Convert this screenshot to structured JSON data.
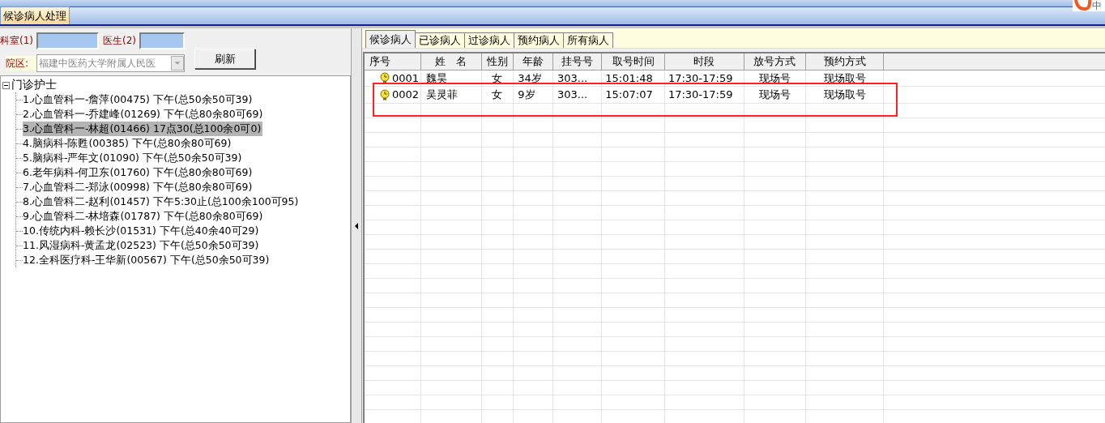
{
  "ime": {
    "label": "中"
  },
  "module_tabs": [
    {
      "label": "候诊病人处理",
      "selected": true
    }
  ],
  "filters": {
    "dept_label": "科室(1)",
    "doctor_label": "医生(2)",
    "campus_label": "院区:",
    "campus_value": "福建中医药大学附属人民医",
    "refresh_button": "刷新"
  },
  "tree": {
    "root": {
      "label": "门诊护士",
      "expanded": true,
      "children": [
        {
          "label": "1.心血管科一-詹萍(00475) 下午(总50余50可39)",
          "selected": false
        },
        {
          "label": "2.心血管科一-乔建峰(01269) 下午(总80余80可69)",
          "selected": false
        },
        {
          "label": "3.心血管科一-林超(01466) 17点30(总100余0可0)",
          "selected": true
        },
        {
          "label": "4.脑病科-陈甦(00385) 下午(总80余80可69)",
          "selected": false
        },
        {
          "label": "5.脑病科-严年文(01090) 下午(总50余50可39)",
          "selected": false
        },
        {
          "label": "6.老年病科-何卫东(01760) 下午(总80余80可69)",
          "selected": false
        },
        {
          "label": "7.心血管科二-郑泳(00998) 下午(总80余80可69)",
          "selected": false
        },
        {
          "label": "8.心血管科二-赵利(01457) 下午5:30止(总100余100可95)",
          "selected": false
        },
        {
          "label": "9.心血管科二-林培森(01787) 下午(总80余80可69)",
          "selected": false
        },
        {
          "label": "10.传统内科-赖长沙(01531) 下午(总40余40可29)",
          "selected": false
        },
        {
          "label": "11.风湿病科-黄孟龙(02523) 下午(总50余50可39)",
          "selected": false
        },
        {
          "label": "12.全科医疗科-王华新(00567) 下午(总50余50可39)",
          "selected": false
        }
      ]
    }
  },
  "patient_tabs": [
    {
      "label": "候诊病人",
      "selected": true
    },
    {
      "label": "已诊病人",
      "selected": false
    },
    {
      "label": "过诊病人",
      "selected": false
    },
    {
      "label": "预约病人",
      "selected": false
    },
    {
      "label": "所有病人",
      "selected": false
    }
  ],
  "table": {
    "columns": [
      "序号",
      "姓　名",
      "性别",
      "年龄",
      "挂号号",
      "取号时间",
      "时段",
      "放号方式",
      "预约方式"
    ],
    "rows": [
      {
        "cells": [
          "0001",
          "魏昊",
          "女",
          "34岁",
          "303...",
          "15:01:48",
          "17:30-17:59",
          "现场号",
          "现场取号"
        ],
        "highlighted": false
      },
      {
        "cells": [
          "0002",
          "吴灵菲",
          "女",
          "9岁",
          "303...",
          "15:07:07",
          "17:30-17:59",
          "现场号",
          "现场取号"
        ],
        "highlighted": true
      }
    ]
  }
}
